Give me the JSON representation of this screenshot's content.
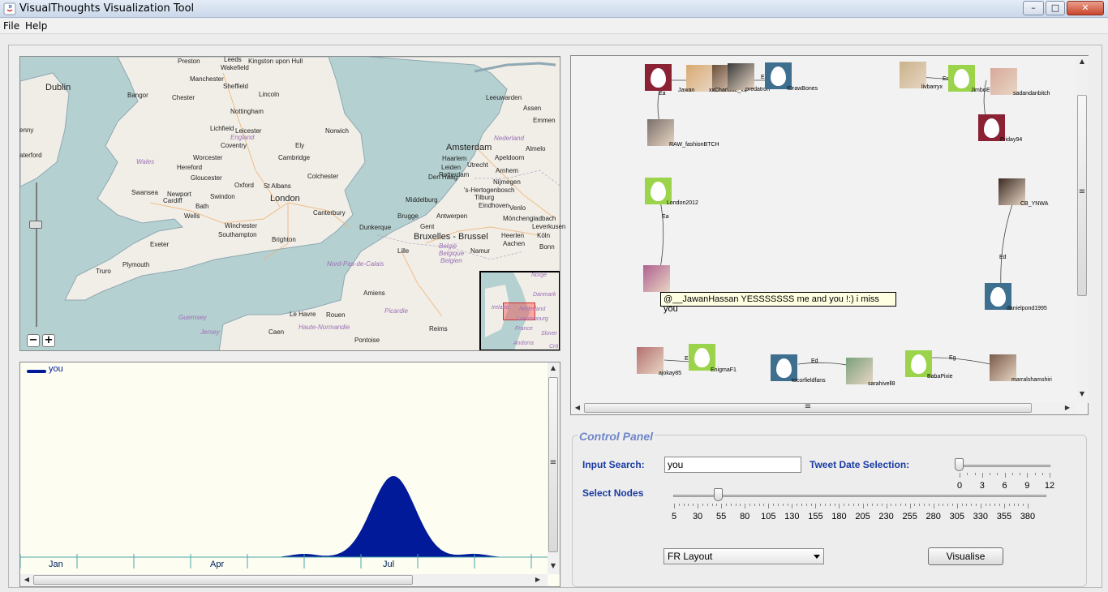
{
  "window": {
    "title": "VisualThoughts Visualization Tool",
    "minimize": "–",
    "maximize": "□",
    "close": "✕"
  },
  "menu": {
    "file": "File",
    "help": "Help"
  },
  "map": {
    "labels": {
      "dublin": "Dublin",
      "enny": "enny",
      "aterford": "aterford",
      "preston": "Preston",
      "leeds": "Leeds",
      "kingston": "Kingston upon Hull",
      "wakefield": "Wakefield",
      "manchester": "Manchester",
      "sheffield": "Sheffield",
      "bangor": "Bangor",
      "chester": "Chester",
      "lincoln": "Lincoln",
      "nottingham": "Nottingham",
      "lichfield": "Lichfield",
      "leicester": "Leicester",
      "england": "England",
      "coventry": "Coventry",
      "ely": "Ely",
      "norwich": "Norwich",
      "wales": "Wales",
      "worcester": "Worcester",
      "cambridge": "Cambridge",
      "hereford": "Hereford",
      "gloucester": "Gloucester",
      "colchester": "Colchester",
      "oxford": "Oxford",
      "st_albans": "St Albans",
      "swansea": "Swansea",
      "newport": "Newport",
      "cardiff": "Cardiff",
      "swindon": "Swindon",
      "london": "London",
      "bath": "Bath",
      "wells": "Wells",
      "canterbury": "Canterbury",
      "winchester": "Winchester",
      "southampton": "Southampton",
      "brighton": "Brighton",
      "exeter": "Exeter",
      "plymouth": "Plymouth",
      "truro": "Truro",
      "le_havre": "Le Havre",
      "guernsey": "Guernsey",
      "jersey": "Jersey",
      "caen": "Caen",
      "rouen": "Rouen",
      "haute_normandie": "Haute-Normandie",
      "pontoise": "Pontoise",
      "amiens": "Amiens",
      "picardie": "Picardie",
      "nord_pas": "Nord-Pas-de-Calais",
      "lille": "Lille",
      "dunkerque": "Dunkerque",
      "brugge": "Brugge",
      "gent": "Gent",
      "antwerpen": "Antwerpen",
      "bruxelles": "Bruxelles - Brussel",
      "belgie": "België",
      "belgique": "Belgique",
      "belgien": "Belgien",
      "middelburg": "Middelburg",
      "amsterdam": "Amsterdam",
      "leeuwarden": "Leeuwarden",
      "assen": "Assen",
      "emmen": "Emmen",
      "nederland": "Nederland",
      "almelo": "Almelo",
      "haarlem": "Haarlem",
      "apeldoorn": "Apeldoorn",
      "leiden": "Leiden",
      "den_haag": "Den Haag",
      "utrecht": "Utrecht",
      "arnhem": "Arnhem",
      "rotterdam": "Rotterdam",
      "nijmegen": "Nijmegen",
      "hertogenbosch": "'s-Hertogenbosch",
      "tilburg": "Tilburg",
      "eindhoven": "Eindhoven",
      "venlo": "Venlo",
      "monchengladbach": "Mönchengladbach",
      "leverkusen": "Leverkusen",
      "koln": "Köln",
      "heerlen": "Heerlen",
      "aachen": "Aachen",
      "bonn": "Bonn",
      "reims": "Reims",
      "namur": "Namur"
    },
    "overview": {
      "norge": "Norge",
      "danmark": "Danmark",
      "ireland": "Ireland",
      "nederland": "Nederland",
      "luxembourg": "Luxembourg",
      "france": "France",
      "andorra": "Andorra",
      "slovenia": "Slover",
      "cro": "Crö"
    },
    "zoom_out": "−",
    "zoom_in": "+"
  },
  "timeseries": {
    "legend": "you",
    "months": [
      "Jan",
      "Apr",
      "Jul"
    ],
    "series_color": "#001a99"
  },
  "graph": {
    "nodes": [
      {
        "label": "",
        "color": "#8b2234"
      },
      {
        "label": "Jawan",
        "color": "#d9a970"
      },
      {
        "label": "xxCharlotte_xx",
        "color": "#6b4f3a"
      },
      {
        "label": "predatron",
        "color": "#3a3a3a"
      },
      {
        "label": "IDrawBones",
        "color": "#3f6f8f"
      },
      {
        "label": "RAW_fashionBTCH",
        "color": "#7a6f6a"
      },
      {
        "label": "livbarryx",
        "color": "#c9b28a"
      },
      {
        "label": "Jimbo",
        "color": "#9bd34a"
      },
      {
        "label": "sadandanbitch",
        "color": "#d8a89a"
      },
      {
        "label": "Friday94",
        "color": "#8b2234"
      },
      {
        "label": "London2012",
        "color": "#9bd34a"
      },
      {
        "label": "CB_YNWA",
        "color": "#3a2a22"
      },
      {
        "label": "",
        "color": "#b06090"
      },
      {
        "label": "danielpond1995",
        "color": "#3f6f8f"
      },
      {
        "label": "ajokay85",
        "color": "#b47070"
      },
      {
        "label": "EnigmaF1",
        "color": "#9bd34a"
      },
      {
        "label": "tocorfieldfans",
        "color": "#3f6f8f"
      },
      {
        "label": "sarahivell8",
        "color": "#7aa07a"
      },
      {
        "label": "BabaPixie",
        "color": "#9bd34a"
      },
      {
        "label": "marralshamshiri",
        "color": "#7a5a4a"
      }
    ],
    "edges": [
      "Ea",
      "Ea",
      "Ed",
      "Ed",
      "Ea",
      "Ed",
      "Ed",
      "Ed",
      "Eg"
    ],
    "tooltip": "@__JawanHassan YESSSSSSS me and you !:) i miss you"
  },
  "control_panel": {
    "title": "Control Panel",
    "input_search_label": "Input Search:",
    "input_search_value": "you",
    "tweet_date_label": "Tweet Date Selection:",
    "date_ticks": [
      "0",
      "3",
      "6",
      "9",
      "12"
    ],
    "date_value": 0,
    "select_nodes_label": "Select Nodes",
    "node_ticks": [
      "5",
      "30",
      "55",
      "80",
      "105",
      "130",
      "155",
      "180",
      "205",
      "230",
      "255",
      "280",
      "305",
      "330",
      "355",
      "380"
    ],
    "nodes_value": 55,
    "layout_selected": "FR Layout",
    "visualise_label": "Visualise"
  },
  "scroll": {
    "up": "▲",
    "down": "▼",
    "left": "◀",
    "right": "▶",
    "grip": "≡"
  }
}
